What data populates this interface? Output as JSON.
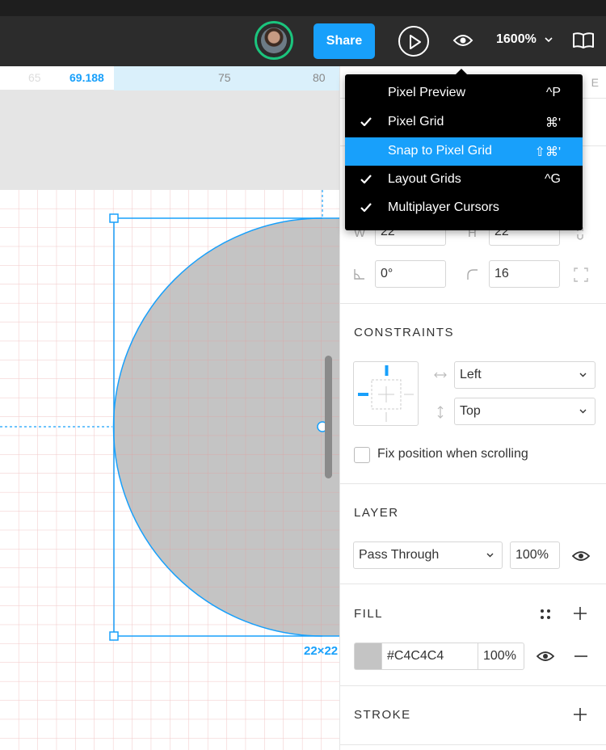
{
  "toolbar": {
    "share_label": "Share",
    "zoom_level": "1600%"
  },
  "ruler": {
    "faint_tick": "65",
    "selection_start": "69.188",
    "tick_75": "75",
    "tick_80": "80"
  },
  "canvas": {
    "dimension_label": "22×22"
  },
  "view_menu": {
    "items": [
      {
        "label": "Pixel Preview",
        "shortcut": "^P",
        "checked": false
      },
      {
        "label": "Pixel Grid",
        "shortcut": "⌘'",
        "checked": true
      },
      {
        "label": "Snap to Pixel Grid",
        "shortcut": "⇧⌘'",
        "checked": false,
        "highlighted": true
      },
      {
        "label": "Layout Grids",
        "shortcut": "^G",
        "checked": true
      },
      {
        "label": "Multiplayer Cursors",
        "shortcut": "",
        "checked": true
      }
    ]
  },
  "panel": {
    "header_tab": "E",
    "width_label": "W",
    "width_value": "22",
    "height_label": "H",
    "height_value": "22",
    "rotation_value": "0°",
    "corner_radius_value": "16",
    "constraints": {
      "title": "CONSTRAINTS",
      "horizontal": "Left",
      "vertical": "Top",
      "fix_position_label": "Fix position when scrolling"
    },
    "layer": {
      "title": "LAYER",
      "blend_mode": "Pass Through",
      "opacity": "100%"
    },
    "fill": {
      "title": "FILL",
      "hex": "#C4C4C4",
      "opacity": "100%",
      "swatch_color": "#c4c4c4"
    },
    "stroke": {
      "title": "STROKE"
    }
  },
  "colors": {
    "accent": "#18a0fb",
    "avatar_ring": "#1bc47d",
    "shape_fill": "#c4c4c4"
  }
}
